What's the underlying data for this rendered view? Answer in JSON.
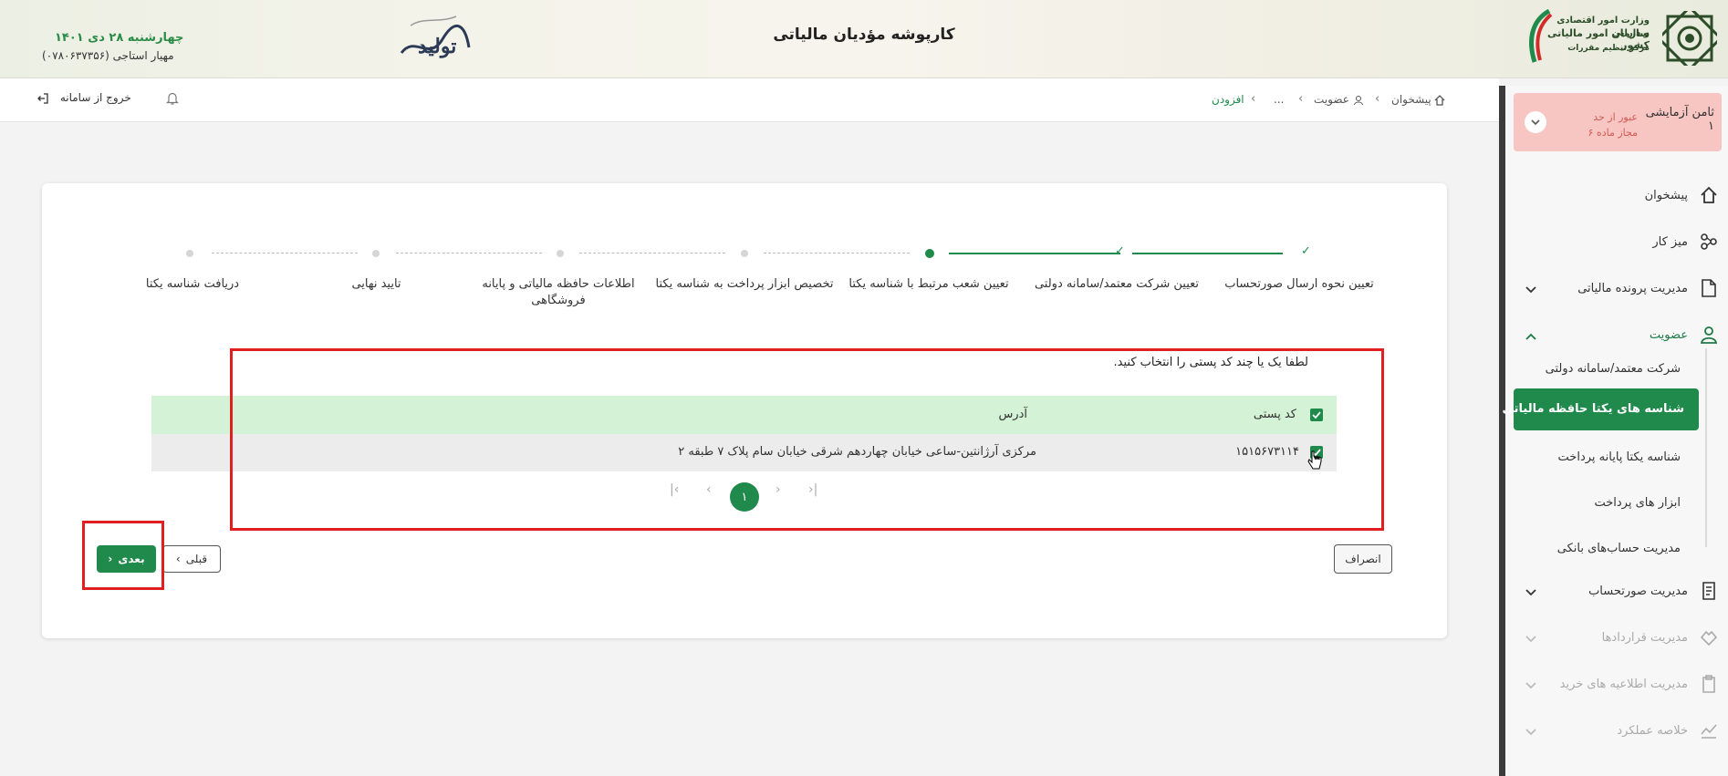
{
  "header": {
    "ministry": "وزارت امور اقتصادی و دارایی",
    "org": "سازمان امور مالیاتی کشور",
    "center": "مرکز تنظیم مقررات",
    "title": "کارپوشه مؤدیان مالیاتی",
    "date": "چهارشنبه ۲۸ دی ۱۴۰۱",
    "user": "مهیار استاجی (۰۷۸۰۶۳۷۳۵۶)",
    "calligraphy": "تولید"
  },
  "topbar": {
    "breadcrumb": [
      "پیشخوان",
      "عضویت",
      "...",
      "افزودن"
    ],
    "logout": "خروج از سامانه"
  },
  "sidebar": {
    "alert": {
      "name": "ثامن آزمایشی ۱",
      "warning": "عبور از حد مجاز ماده ۶"
    },
    "items": [
      {
        "label": "پیشخوان",
        "icon": "home-icon"
      },
      {
        "label": "میز کار",
        "icon": "workflow-icon"
      },
      {
        "label": "مدیریت پرونده مالیاتی",
        "icon": "file-icon"
      },
      {
        "label": "عضویت",
        "icon": "user-icon"
      }
    ],
    "subitems": [
      {
        "label": "شرکت معتمد/سامانه دولتی"
      },
      {
        "label": "شناسه های یکتا حافظه مالیاتی"
      },
      {
        "label": "شناسه یکتا پایانه پرداخت"
      },
      {
        "label": "ابزار های پرداخت"
      },
      {
        "label": "مدیریت حساب‌های بانکی"
      }
    ],
    "more_items": [
      {
        "label": "مدیریت صورتحساب",
        "icon": "invoice-icon"
      },
      {
        "label": "مدیریت قراردادها",
        "icon": "handshake-icon"
      },
      {
        "label": "مدیریت اطلاعیه های خرید",
        "icon": "clipboard-icon"
      },
      {
        "label": "خلاصه عملکرد",
        "icon": "chart-icon"
      }
    ]
  },
  "stepper": {
    "steps": [
      {
        "label": "تعیین نحوه ارسال صورتحساب",
        "state": "done"
      },
      {
        "label": "تعیین شرکت معتمد/سامانه دولتی",
        "state": "done"
      },
      {
        "label": "تعیین شعب مرتبط با شناسه یکتا",
        "state": "current"
      },
      {
        "label": "تخصیص ابزار پرداخت به شناسه یکتا",
        "state": "todo"
      },
      {
        "label": "اطلاعات حافظه مالیاتی و پایانه فروشگاهی",
        "state": "todo"
      },
      {
        "label": "تایید نهایی",
        "state": "todo"
      },
      {
        "label": "دریافت شناسه یکتا",
        "state": "todo"
      }
    ]
  },
  "form": {
    "instruction": "لطفا یک یا چند کد پستی را انتخاب کنید.",
    "columns": {
      "postal": "کد پستی",
      "address": "آدرس"
    },
    "rows": [
      {
        "postal": "۱۵۱۵۶۷۳۱۱۴",
        "address": "مرکزی آرژانتین-ساعی خیابان چهاردهم شرقی خیابان سام پلاک ۷ طبقه ۲",
        "checked": true
      }
    ],
    "page": "۱"
  },
  "buttons": {
    "next": "بعدی",
    "prev": "قبلی",
    "cancel": "انصراف"
  },
  "colors": {
    "primary": "#1f8a4c",
    "highlight": "#e02020",
    "table_header": "#d4f3d6",
    "alert_bg": "#f7c5c2"
  }
}
